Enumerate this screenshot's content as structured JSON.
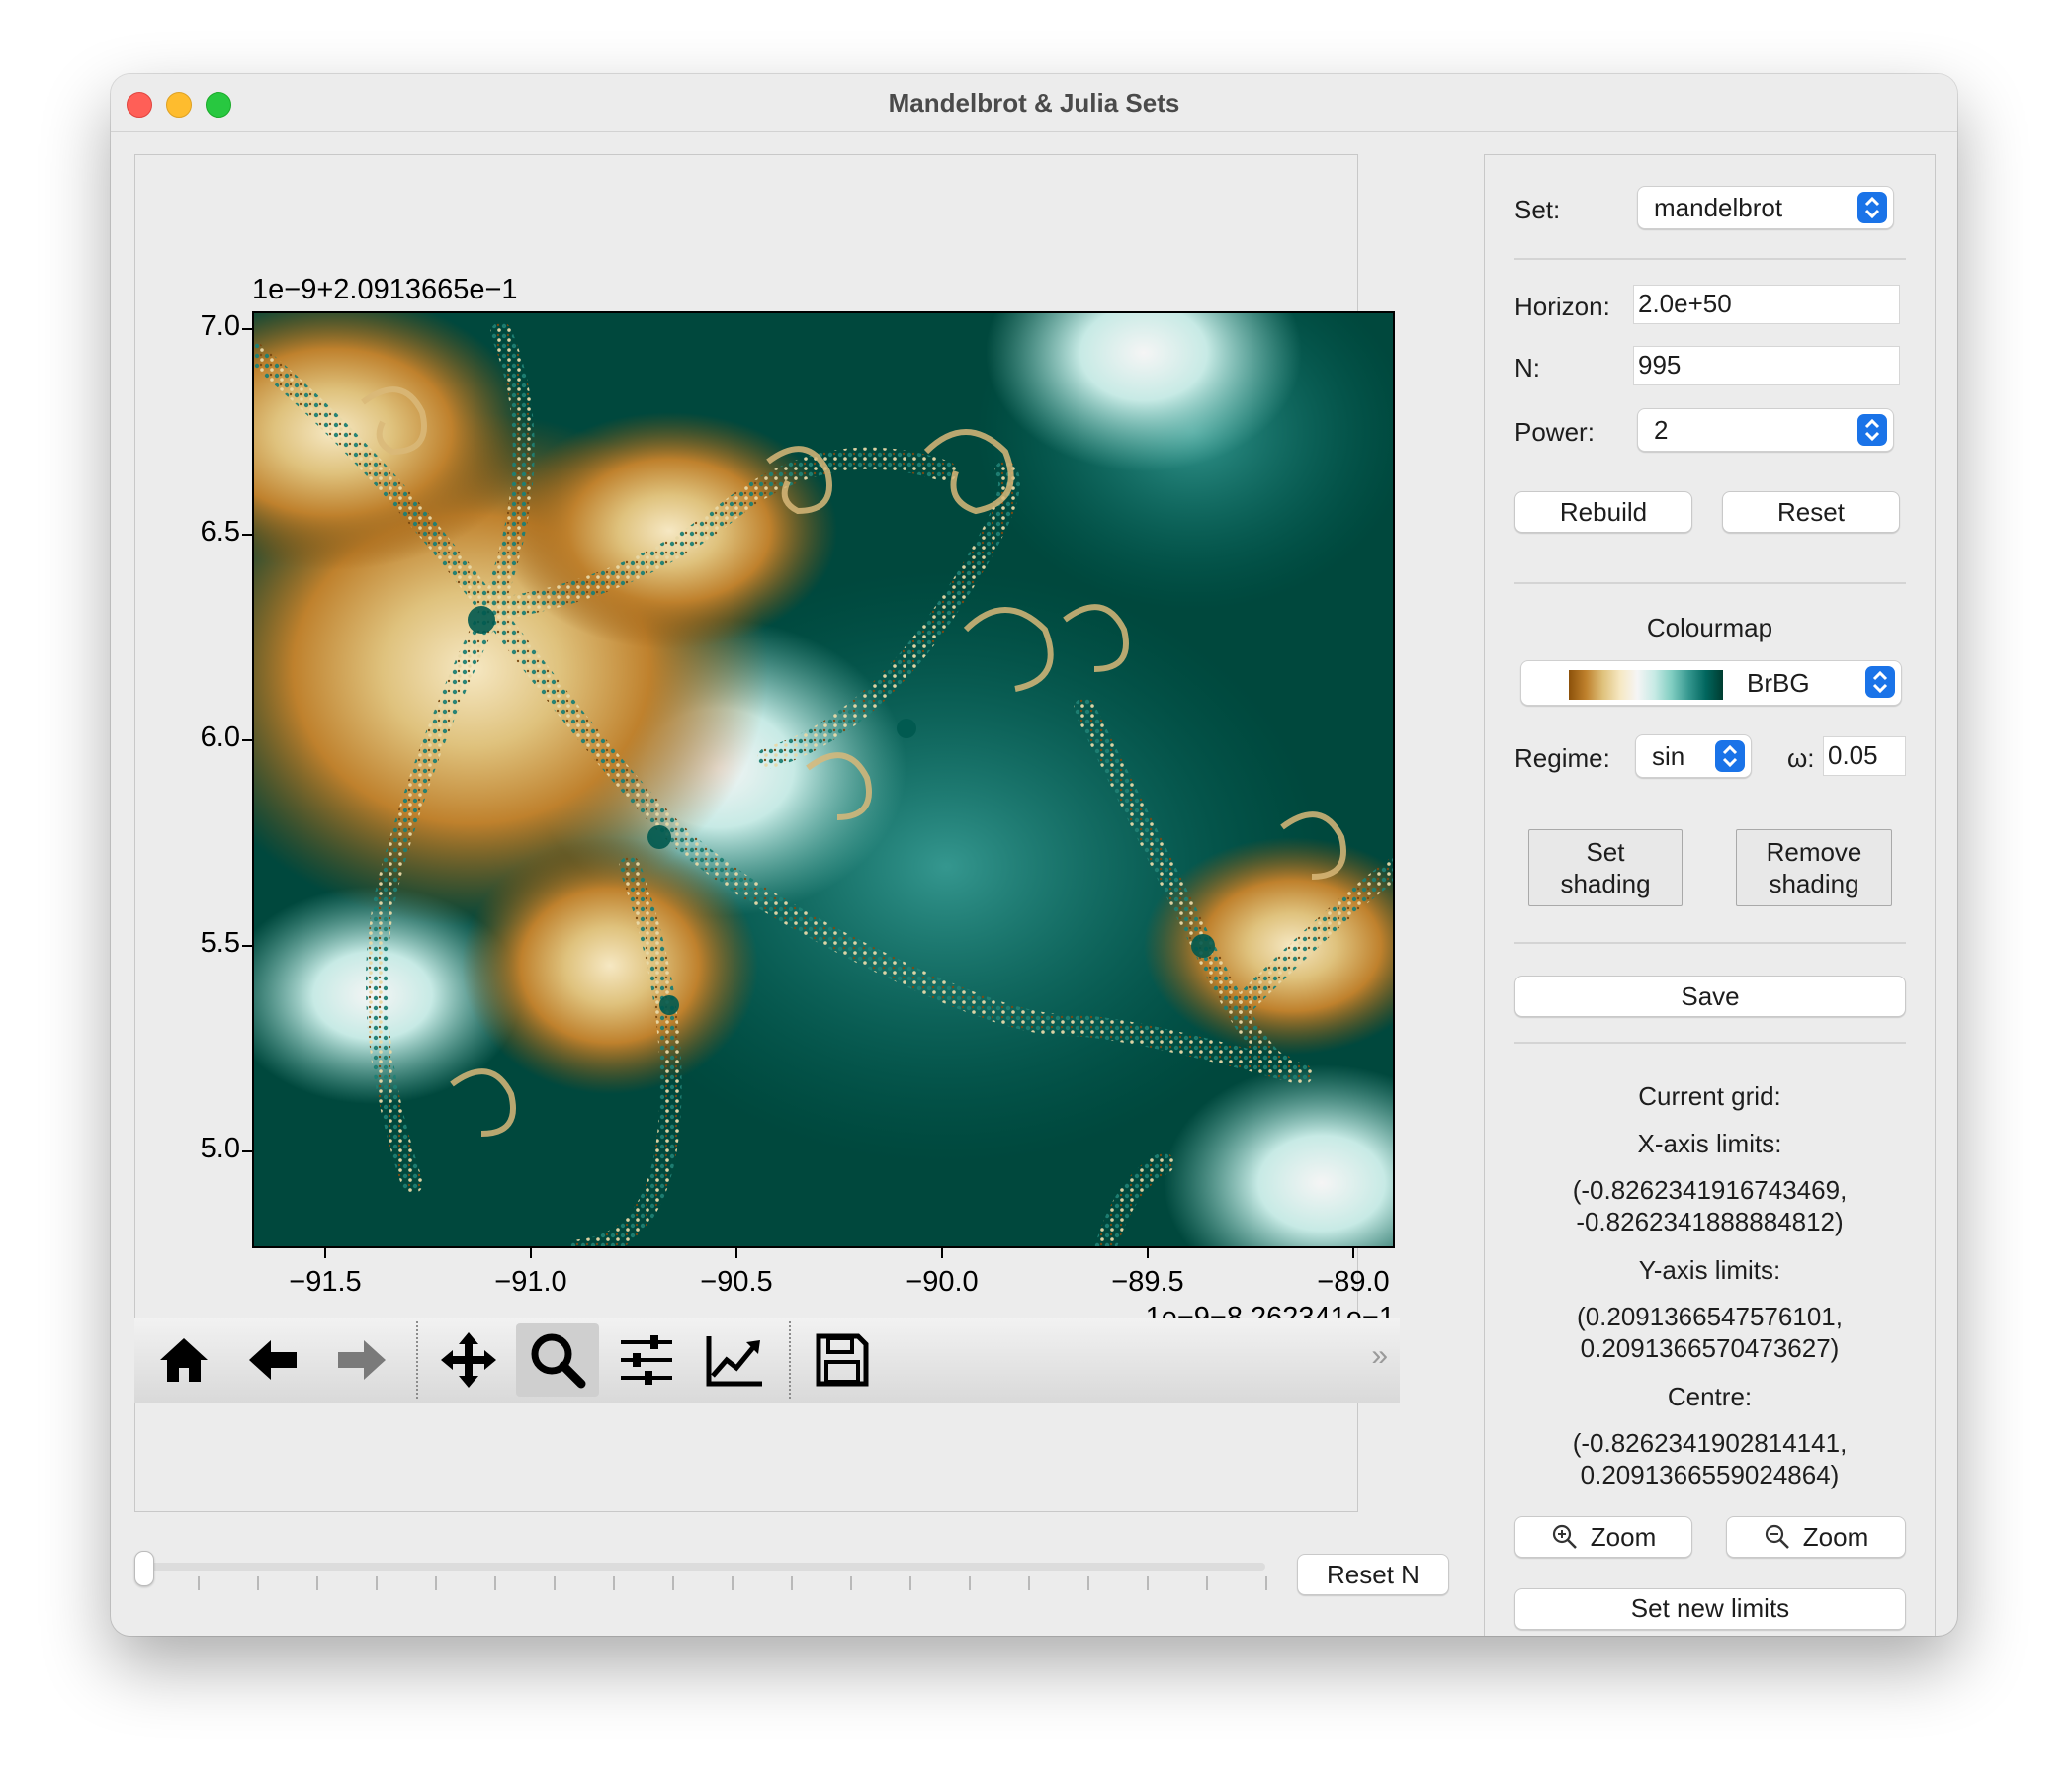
{
  "window": {
    "title": "Mandelbrot & Julia Sets"
  },
  "plot": {
    "offset_top": "1e−9+2.0913665e−1",
    "offset_bottom": "1e−9−8.262341e−1",
    "y_ticks": [
      "7.0",
      "6.5",
      "6.0",
      "5.5",
      "5.0"
    ],
    "x_ticks": [
      "−91.5",
      "−91.0",
      "−90.5",
      "−90.0",
      "−89.5",
      "−89.0"
    ],
    "image": "mandelbrot-fractal-brbg"
  },
  "toolbar": {
    "items": [
      "home-icon",
      "back-icon",
      "forward-icon",
      "pan-icon",
      "zoom-icon",
      "configure-subplots-icon",
      "edit-axes-icon",
      "save-icon"
    ],
    "active": "zoom-icon",
    "more": "»"
  },
  "slider": {
    "value": 0,
    "ticks": 20
  },
  "reset_n_label": "Reset N",
  "controls": {
    "set_label": "Set:",
    "set_value": "mandelbrot",
    "horizon_label": "Horizon:",
    "horizon_value": "2.0e+50",
    "n_label": "N:",
    "n_value": "995",
    "power_label": "Power:",
    "power_value": "2",
    "rebuild_label": "Rebuild",
    "reset_label": "Reset",
    "colourmap_heading": "Colourmap",
    "colourmap_value": "BrBG",
    "regime_label": "Regime:",
    "regime_value": "sin",
    "omega_label": "ω:",
    "omega_value": "0.05",
    "set_shading_label": "Set\nshading",
    "remove_shading_label": "Remove\nshading",
    "save_label": "Save"
  },
  "info": {
    "current_grid": "Current grid:",
    "x_limits_label": "X-axis limits:",
    "x_limits_line1": "(-0.8262341916743469,",
    "x_limits_line2": "-0.8262341888884812)",
    "y_limits_label": "Y-axis limits:",
    "y_limits_line1": "(0.2091366547576101,",
    "y_limits_line2": "0.2091366570473627)",
    "centre_label": "Centre:",
    "centre_line1": "(-0.8262341902814141,",
    "centre_line2": "0.2091366559024864)"
  },
  "zoom_in_label": "Zoom",
  "zoom_out_label": "Zoom",
  "set_new_limits_label": "Set new limits",
  "colors": {
    "accent": "#1a73e8",
    "teal_dark": "#00483d",
    "brown": "#8c510a"
  }
}
